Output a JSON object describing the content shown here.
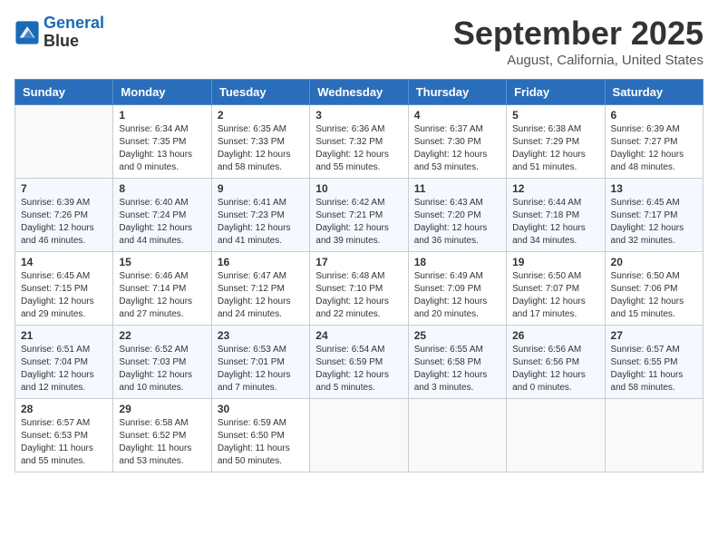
{
  "header": {
    "logo_line1": "General",
    "logo_line2": "Blue",
    "month": "September 2025",
    "location": "August, California, United States"
  },
  "weekdays": [
    "Sunday",
    "Monday",
    "Tuesday",
    "Wednesday",
    "Thursday",
    "Friday",
    "Saturday"
  ],
  "weeks": [
    [
      {
        "day": "",
        "sunrise": "",
        "sunset": "",
        "daylight": ""
      },
      {
        "day": "1",
        "sunrise": "Sunrise: 6:34 AM",
        "sunset": "Sunset: 7:35 PM",
        "daylight": "Daylight: 13 hours and 0 minutes."
      },
      {
        "day": "2",
        "sunrise": "Sunrise: 6:35 AM",
        "sunset": "Sunset: 7:33 PM",
        "daylight": "Daylight: 12 hours and 58 minutes."
      },
      {
        "day": "3",
        "sunrise": "Sunrise: 6:36 AM",
        "sunset": "Sunset: 7:32 PM",
        "daylight": "Daylight: 12 hours and 55 minutes."
      },
      {
        "day": "4",
        "sunrise": "Sunrise: 6:37 AM",
        "sunset": "Sunset: 7:30 PM",
        "daylight": "Daylight: 12 hours and 53 minutes."
      },
      {
        "day": "5",
        "sunrise": "Sunrise: 6:38 AM",
        "sunset": "Sunset: 7:29 PM",
        "daylight": "Daylight: 12 hours and 51 minutes."
      },
      {
        "day": "6",
        "sunrise": "Sunrise: 6:39 AM",
        "sunset": "Sunset: 7:27 PM",
        "daylight": "Daylight: 12 hours and 48 minutes."
      }
    ],
    [
      {
        "day": "7",
        "sunrise": "Sunrise: 6:39 AM",
        "sunset": "Sunset: 7:26 PM",
        "daylight": "Daylight: 12 hours and 46 minutes."
      },
      {
        "day": "8",
        "sunrise": "Sunrise: 6:40 AM",
        "sunset": "Sunset: 7:24 PM",
        "daylight": "Daylight: 12 hours and 44 minutes."
      },
      {
        "day": "9",
        "sunrise": "Sunrise: 6:41 AM",
        "sunset": "Sunset: 7:23 PM",
        "daylight": "Daylight: 12 hours and 41 minutes."
      },
      {
        "day": "10",
        "sunrise": "Sunrise: 6:42 AM",
        "sunset": "Sunset: 7:21 PM",
        "daylight": "Daylight: 12 hours and 39 minutes."
      },
      {
        "day": "11",
        "sunrise": "Sunrise: 6:43 AM",
        "sunset": "Sunset: 7:20 PM",
        "daylight": "Daylight: 12 hours and 36 minutes."
      },
      {
        "day": "12",
        "sunrise": "Sunrise: 6:44 AM",
        "sunset": "Sunset: 7:18 PM",
        "daylight": "Daylight: 12 hours and 34 minutes."
      },
      {
        "day": "13",
        "sunrise": "Sunrise: 6:45 AM",
        "sunset": "Sunset: 7:17 PM",
        "daylight": "Daylight: 12 hours and 32 minutes."
      }
    ],
    [
      {
        "day": "14",
        "sunrise": "Sunrise: 6:45 AM",
        "sunset": "Sunset: 7:15 PM",
        "daylight": "Daylight: 12 hours and 29 minutes."
      },
      {
        "day": "15",
        "sunrise": "Sunrise: 6:46 AM",
        "sunset": "Sunset: 7:14 PM",
        "daylight": "Daylight: 12 hours and 27 minutes."
      },
      {
        "day": "16",
        "sunrise": "Sunrise: 6:47 AM",
        "sunset": "Sunset: 7:12 PM",
        "daylight": "Daylight: 12 hours and 24 minutes."
      },
      {
        "day": "17",
        "sunrise": "Sunrise: 6:48 AM",
        "sunset": "Sunset: 7:10 PM",
        "daylight": "Daylight: 12 hours and 22 minutes."
      },
      {
        "day": "18",
        "sunrise": "Sunrise: 6:49 AM",
        "sunset": "Sunset: 7:09 PM",
        "daylight": "Daylight: 12 hours and 20 minutes."
      },
      {
        "day": "19",
        "sunrise": "Sunrise: 6:50 AM",
        "sunset": "Sunset: 7:07 PM",
        "daylight": "Daylight: 12 hours and 17 minutes."
      },
      {
        "day": "20",
        "sunrise": "Sunrise: 6:50 AM",
        "sunset": "Sunset: 7:06 PM",
        "daylight": "Daylight: 12 hours and 15 minutes."
      }
    ],
    [
      {
        "day": "21",
        "sunrise": "Sunrise: 6:51 AM",
        "sunset": "Sunset: 7:04 PM",
        "daylight": "Daylight: 12 hours and 12 minutes."
      },
      {
        "day": "22",
        "sunrise": "Sunrise: 6:52 AM",
        "sunset": "Sunset: 7:03 PM",
        "daylight": "Daylight: 12 hours and 10 minutes."
      },
      {
        "day": "23",
        "sunrise": "Sunrise: 6:53 AM",
        "sunset": "Sunset: 7:01 PM",
        "daylight": "Daylight: 12 hours and 7 minutes."
      },
      {
        "day": "24",
        "sunrise": "Sunrise: 6:54 AM",
        "sunset": "Sunset: 6:59 PM",
        "daylight": "Daylight: 12 hours and 5 minutes."
      },
      {
        "day": "25",
        "sunrise": "Sunrise: 6:55 AM",
        "sunset": "Sunset: 6:58 PM",
        "daylight": "Daylight: 12 hours and 3 minutes."
      },
      {
        "day": "26",
        "sunrise": "Sunrise: 6:56 AM",
        "sunset": "Sunset: 6:56 PM",
        "daylight": "Daylight: 12 hours and 0 minutes."
      },
      {
        "day": "27",
        "sunrise": "Sunrise: 6:57 AM",
        "sunset": "Sunset: 6:55 PM",
        "daylight": "Daylight: 11 hours and 58 minutes."
      }
    ],
    [
      {
        "day": "28",
        "sunrise": "Sunrise: 6:57 AM",
        "sunset": "Sunset: 6:53 PM",
        "daylight": "Daylight: 11 hours and 55 minutes."
      },
      {
        "day": "29",
        "sunrise": "Sunrise: 6:58 AM",
        "sunset": "Sunset: 6:52 PM",
        "daylight": "Daylight: 11 hours and 53 minutes."
      },
      {
        "day": "30",
        "sunrise": "Sunrise: 6:59 AM",
        "sunset": "Sunset: 6:50 PM",
        "daylight": "Daylight: 11 hours and 50 minutes."
      },
      {
        "day": "",
        "sunrise": "",
        "sunset": "",
        "daylight": ""
      },
      {
        "day": "",
        "sunrise": "",
        "sunset": "",
        "daylight": ""
      },
      {
        "day": "",
        "sunrise": "",
        "sunset": "",
        "daylight": ""
      },
      {
        "day": "",
        "sunrise": "",
        "sunset": "",
        "daylight": ""
      }
    ]
  ]
}
